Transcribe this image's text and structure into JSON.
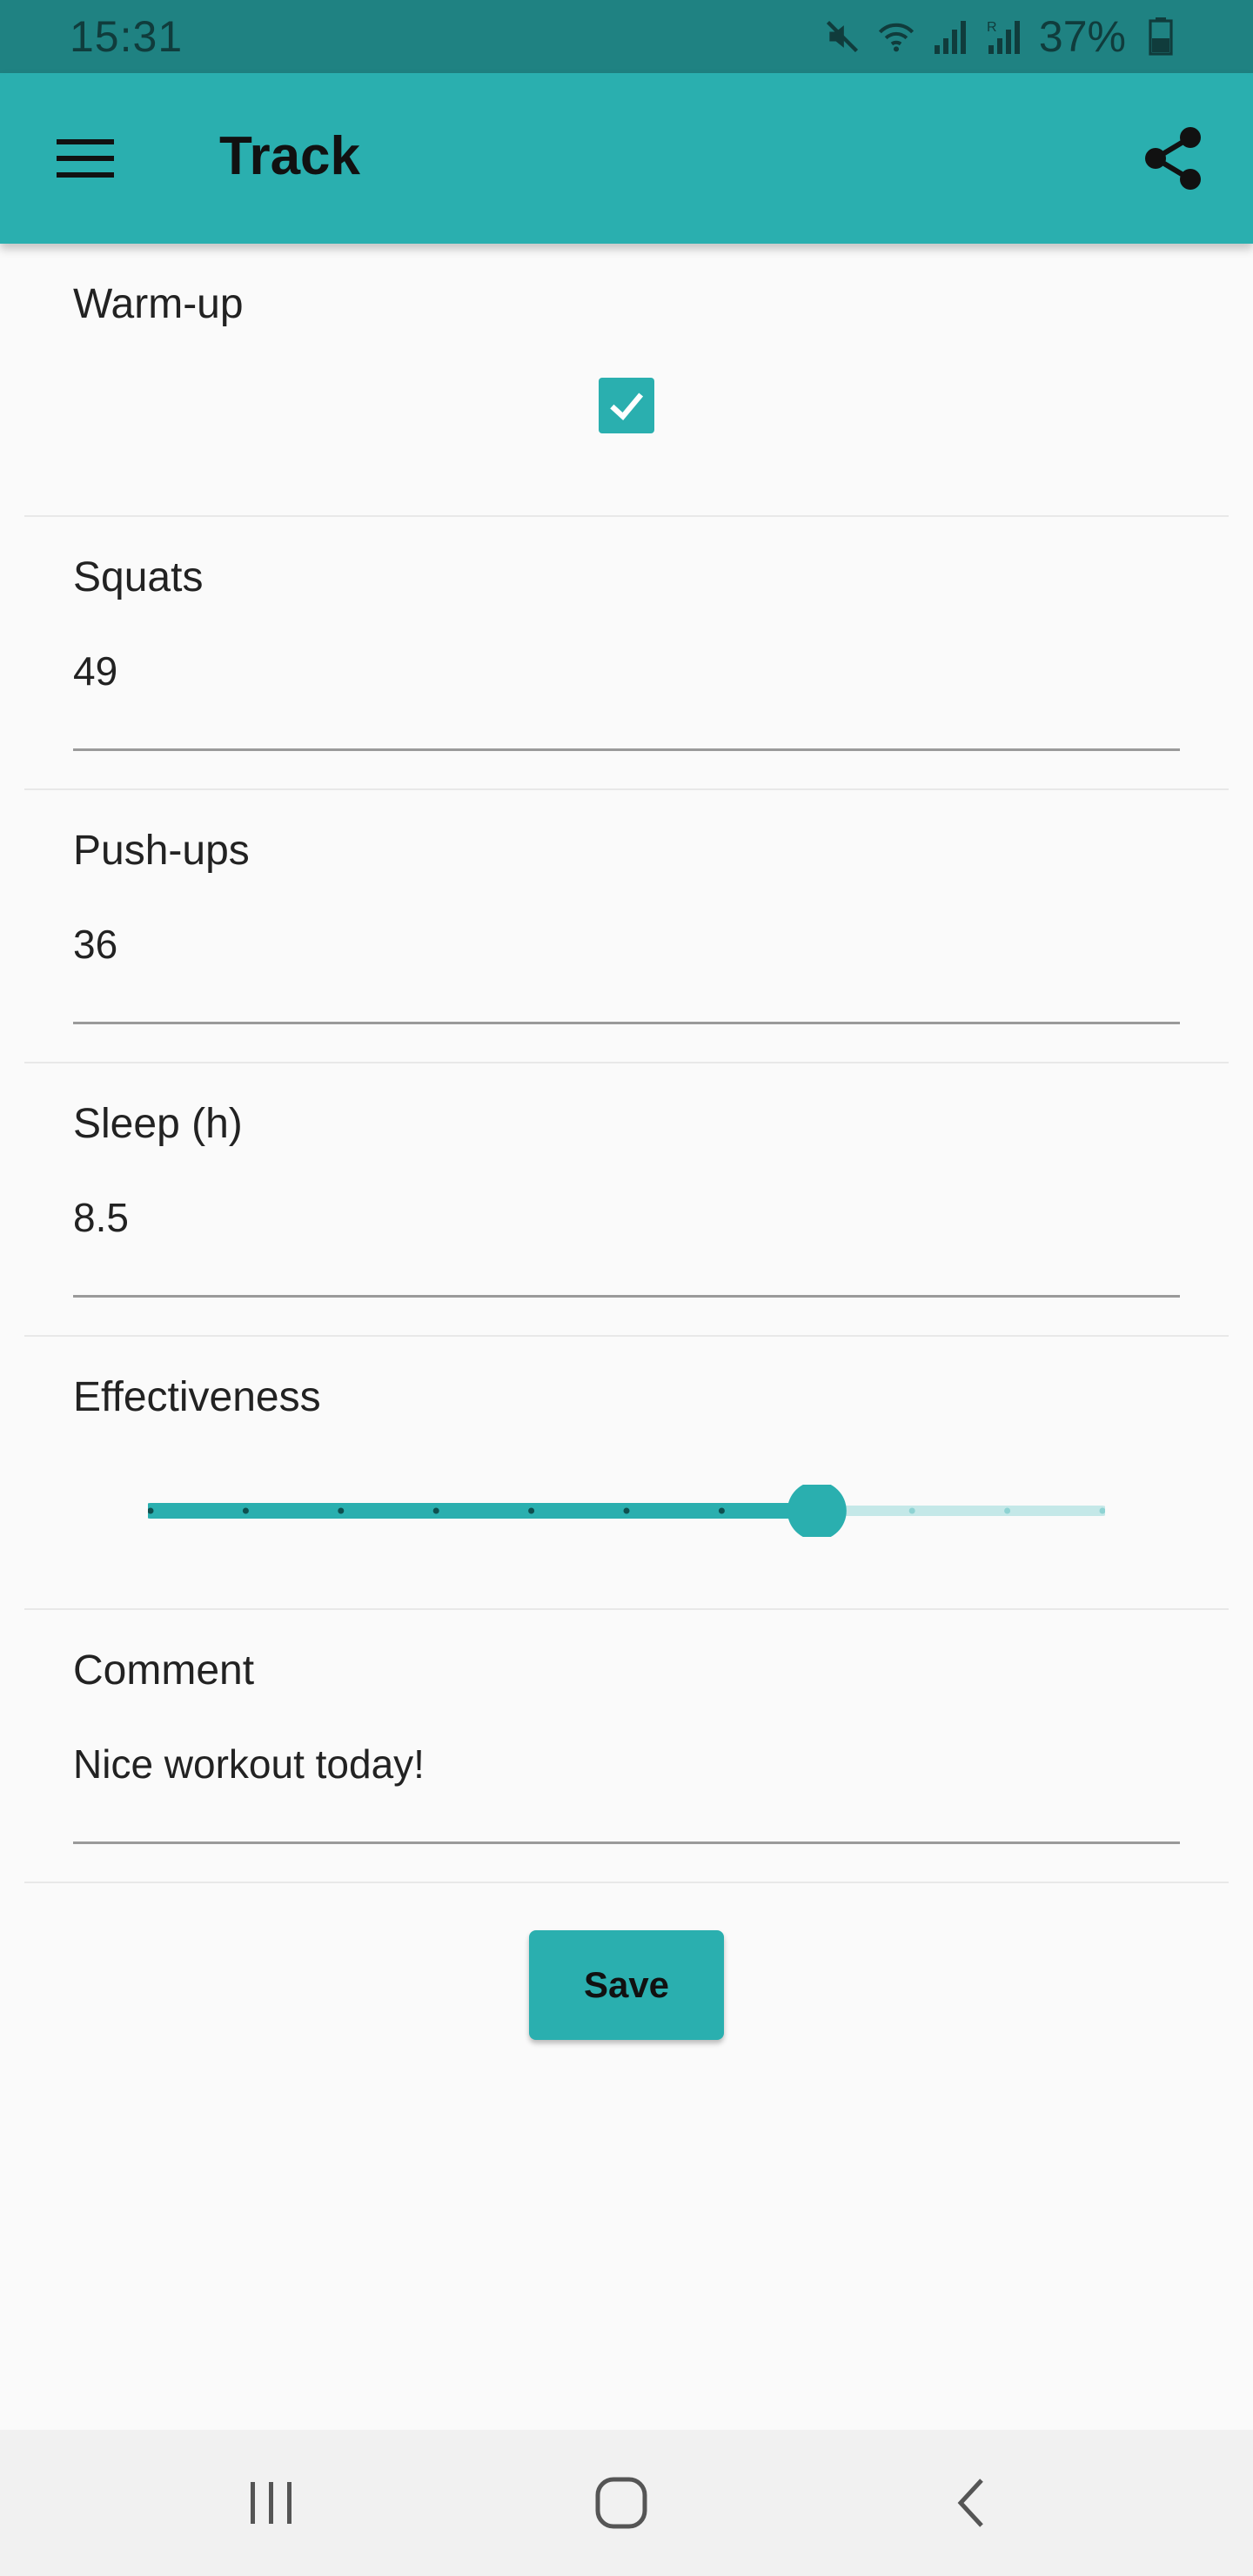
{
  "status_bar": {
    "time": "15:31",
    "battery_percent": "37%",
    "icons": [
      "mute-icon",
      "wifi-icon",
      "signal-icon",
      "roaming-signal-icon",
      "battery-icon"
    ]
  },
  "app_bar": {
    "title": "Track",
    "menu_icon": "hamburger-menu-icon",
    "share_icon": "share-icon"
  },
  "colors": {
    "accent": "#2aafaf",
    "status_bar": "#1f8282",
    "background": "#fafafa"
  },
  "form": {
    "warmup": {
      "label": "Warm-up",
      "checked": true
    },
    "squats": {
      "label": "Squats",
      "value": "49"
    },
    "pushups": {
      "label": "Push-ups",
      "value": "36"
    },
    "sleep": {
      "label": "Sleep (h)",
      "value": "8.5"
    },
    "effectiveness": {
      "label": "Effectiveness",
      "value": 7,
      "max": 10
    },
    "comment": {
      "label": "Comment",
      "value": "Nice workout today!"
    }
  },
  "actions": {
    "save_label": "Save"
  },
  "nav_bar": {
    "icons": [
      "recent-apps-icon",
      "home-icon",
      "back-icon"
    ]
  }
}
